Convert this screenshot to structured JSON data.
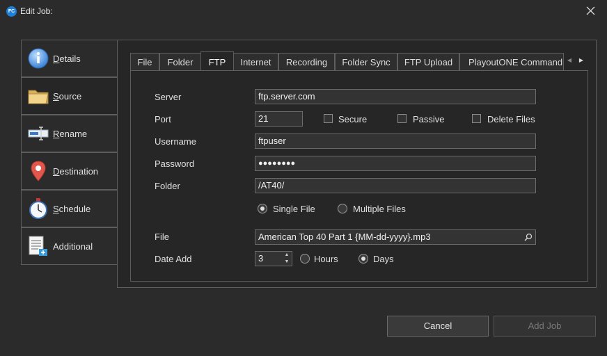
{
  "window": {
    "title": "Edit Job:",
    "app_icon_text": "FC"
  },
  "nav": {
    "items": [
      {
        "label": "Details",
        "icon": "info-icon"
      },
      {
        "label": "Source",
        "icon": "folder-icon"
      },
      {
        "label": "Rename",
        "icon": "rename-icon"
      },
      {
        "label": "Destination",
        "icon": "location-pin-icon"
      },
      {
        "label": "Schedule",
        "icon": "stopwatch-icon"
      },
      {
        "label": "Additional",
        "icon": "document-add-icon"
      }
    ],
    "active": "Source"
  },
  "tabs": {
    "items": [
      "File",
      "Folder",
      "FTP",
      "Internet",
      "Recording",
      "Folder Sync",
      "FTP Upload",
      "PlayoutONE Command"
    ],
    "active": "FTP"
  },
  "form": {
    "server_label": "Server",
    "server_value": "ftp.server.com",
    "port_label": "Port",
    "port_value": "21",
    "secure_label": "Secure",
    "passive_label": "Passive",
    "delete_files_label": "Delete Files",
    "username_label": "Username",
    "username_value": "ftpuser",
    "password_label": "Password",
    "password_value": "●●●●●●●●",
    "folder_label": "Folder",
    "folder_value": "/AT40/",
    "single_file_label": "Single File",
    "multiple_files_label": "Multiple Files",
    "file_mode": "Single File",
    "file_label": "File",
    "file_value": "American Top 40 Part 1 {MM-dd-yyyy}.mp3",
    "date_add_label": "Date Add",
    "date_add_value": "3",
    "hours_label": "Hours",
    "days_label": "Days",
    "date_unit": "Days",
    "secure_checked": false,
    "passive_checked": false,
    "delete_files_checked": false
  },
  "buttons": {
    "cancel": "Cancel",
    "add_job": "Add Job"
  },
  "colors": {
    "background": "#2b2b2b",
    "panel": "#262626",
    "border": "#5e5e5e",
    "accent": "#1e7fd8"
  }
}
